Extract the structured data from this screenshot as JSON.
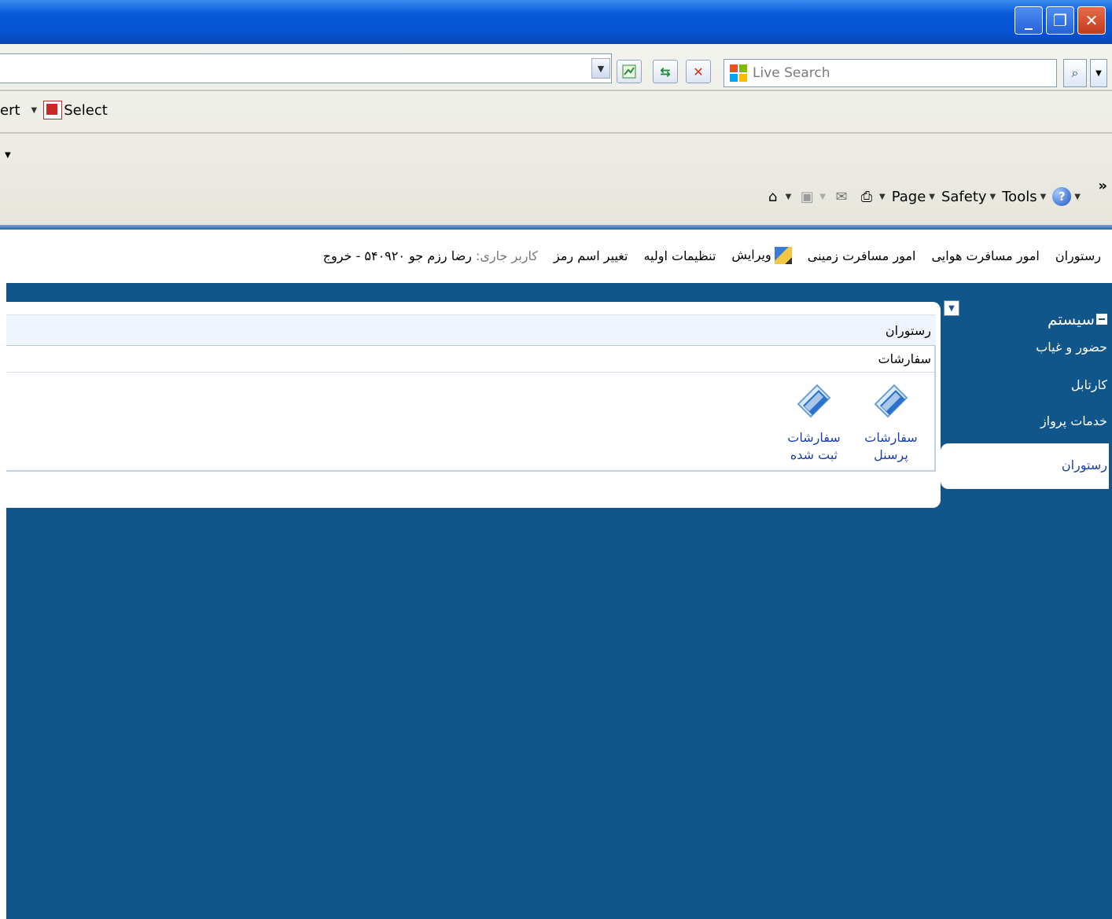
{
  "browser": {
    "search_placeholder": "Live Search",
    "pdf_toolbar": {
      "left_partial": "ert",
      "select_label": "Select"
    },
    "command_bar": {
      "page": "Page",
      "safety": "Safety",
      "tools": "Tools",
      "more": "»"
    }
  },
  "window_buttons": {
    "minimize": "_",
    "restore": "❐",
    "close": "✕"
  },
  "topnav": {
    "items": [
      "رستوران",
      "امور مسافرت هوایی",
      "امور مسافرت زمینی",
      "ویرایش",
      "تنظیمات اولیه",
      "تغییر اسم رمز"
    ],
    "current_user_label": "کاربر جاری:",
    "current_user": "رضا رزم جو ۵۴۰۹۲۰",
    "logout": "- خروج"
  },
  "sidebar": {
    "title": "سیستم",
    "items": [
      "حضور و غیاب",
      "کارتابل",
      "خدمات پرواز"
    ],
    "active_item": "رستوران"
  },
  "panel": {
    "title": "رستوران",
    "section_title": "سفارشات",
    "tiles": [
      {
        "line1": "سفارشات",
        "line2": "پرسنل"
      },
      {
        "line1": "سفارشات",
        "line2": "ثبت شده"
      }
    ]
  },
  "colors": {
    "content_bg": "#11568a",
    "link": "#1b3fa6",
    "titlebar": "#0553d3"
  }
}
